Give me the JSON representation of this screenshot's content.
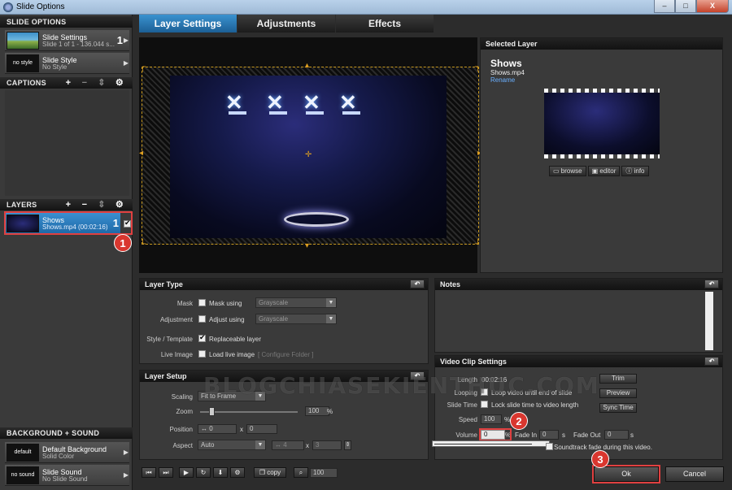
{
  "window": {
    "title": "Slide Options",
    "min": "–",
    "max": "□",
    "close": "X"
  },
  "slide_options": {
    "header": "SLIDE OPTIONS",
    "settings": {
      "title": "Slide Settings",
      "subtitle": "Slide 1 of 1 - 136.044 s...",
      "num": "1"
    },
    "style": {
      "title": "Slide Style",
      "subtitle": "No Style",
      "thumb": "no style"
    }
  },
  "captions": {
    "header": "CAPTIONS"
  },
  "layers": {
    "header": "LAYERS",
    "item": {
      "title": "Shows",
      "subtitle": "Shows.mp4 (00:02:16)",
      "num": "1"
    }
  },
  "bg_sound": {
    "header": "BACKGROUND + SOUND",
    "background": {
      "title": "Default Background",
      "subtitle": "Solid Color",
      "thumb": "default"
    },
    "sound": {
      "title": "Slide Sound",
      "subtitle": "No Slide Sound",
      "thumb": "no sound"
    }
  },
  "tabs": [
    "Layer Settings",
    "Adjustments",
    "Effects"
  ],
  "selected_layer": {
    "header": "Selected Layer",
    "name": "Shows",
    "file": "Shows.mp4",
    "rename": "Rename",
    "buttons": [
      "browse",
      "editor",
      "info"
    ]
  },
  "layer_type": {
    "header": "Layer Type",
    "mask_label": "Mask",
    "mask_text": "Mask using",
    "mask_select": "Grayscale",
    "adj_label": "Adjustment",
    "adj_text": "Adjust using",
    "adj_select": "Grayscale",
    "style_label": "Style / Template",
    "style_text": "Replaceable layer",
    "live_label": "Live Image",
    "live_text": "Load live image",
    "configure": "[ Configure Folder ]"
  },
  "layer_setup": {
    "header": "Layer Setup",
    "scaling_label": "Scaling",
    "scaling_value": "Fit to Frame",
    "zoom_label": "Zoom",
    "zoom_value": "100",
    "zoom_unit": "%",
    "position_label": "Position",
    "pos_x": "0",
    "pos_y": "0",
    "x_sep": "x",
    "aspect_label": "Aspect",
    "aspect_value": "Auto",
    "asp_w": "4",
    "asp_h": "3"
  },
  "notes": {
    "header": "Notes"
  },
  "video_clip": {
    "header": "Video Clip Settings",
    "length_label": "Length",
    "length_value": "00:02:16",
    "looping_label": "Looping",
    "looping_text": "Loop video until end of slide",
    "slide_time_label": "Slide Time",
    "slide_time_text": "Lock slide time to video length",
    "speed_label": "Speed",
    "speed_value": "100",
    "speed_unit": "%",
    "volume_label": "Volume",
    "volume_value": "0",
    "volume_unit": "%",
    "fade_in_label": "Fade In",
    "fade_in_value": "0",
    "fade_out_label": "Fade Out",
    "fade_out_value": "0",
    "sec_unit": "s",
    "soundtrack_text": "Soundtrack fade during this video.",
    "trim": "Trim",
    "preview": "Preview",
    "sync": "Sync Time"
  },
  "bottom": {
    "copy": "copy",
    "zoom": "100"
  },
  "ok": "Ok",
  "cancel": "Cancel",
  "badges": [
    "1",
    "2",
    "3"
  ],
  "watermark": "BLOGCHIASEKIENTHUC.COM",
  "colors": {
    "accent": "#2b83c4",
    "highlight": "#e04040"
  }
}
